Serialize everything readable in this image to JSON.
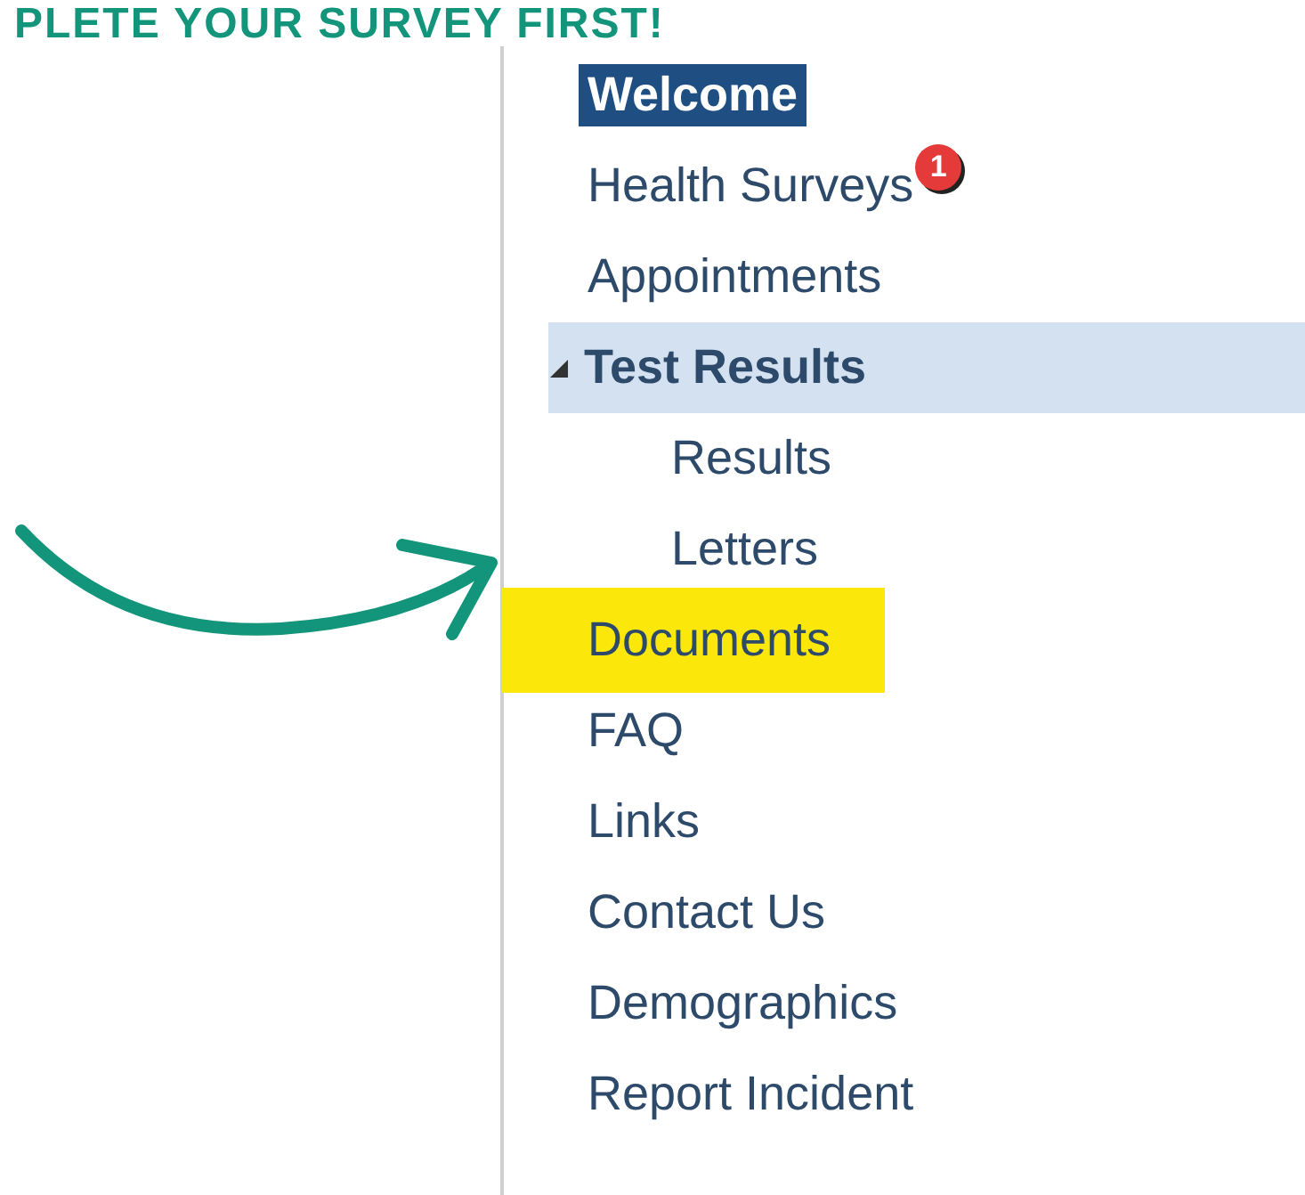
{
  "banner": {
    "text": "PLETE YOUR SURVEY FIRST!"
  },
  "nav": {
    "items": [
      {
        "label": "Welcome",
        "selected": true,
        "highlighted": false
      },
      {
        "label": "Health Surveys",
        "selected": false,
        "highlighted": false,
        "badge": "1"
      },
      {
        "label": "Appointments",
        "selected": false,
        "highlighted": false
      },
      {
        "label": "Test Results",
        "selected": false,
        "highlighted": false,
        "expanded": true,
        "children": [
          {
            "label": "Results",
            "selected": false,
            "highlighted": false
          },
          {
            "label": "Letters",
            "selected": false,
            "highlighted": false
          }
        ]
      },
      {
        "label": "Documents",
        "selected": false,
        "highlighted": true
      },
      {
        "label": "FAQ",
        "selected": false,
        "highlighted": false
      },
      {
        "label": "Links",
        "selected": false,
        "highlighted": false
      },
      {
        "label": "Contact Us",
        "selected": false,
        "highlighted": false
      },
      {
        "label": "Demographics",
        "selected": false,
        "highlighted": false
      },
      {
        "label": "Report Incident",
        "selected": false,
        "highlighted": false
      }
    ]
  }
}
